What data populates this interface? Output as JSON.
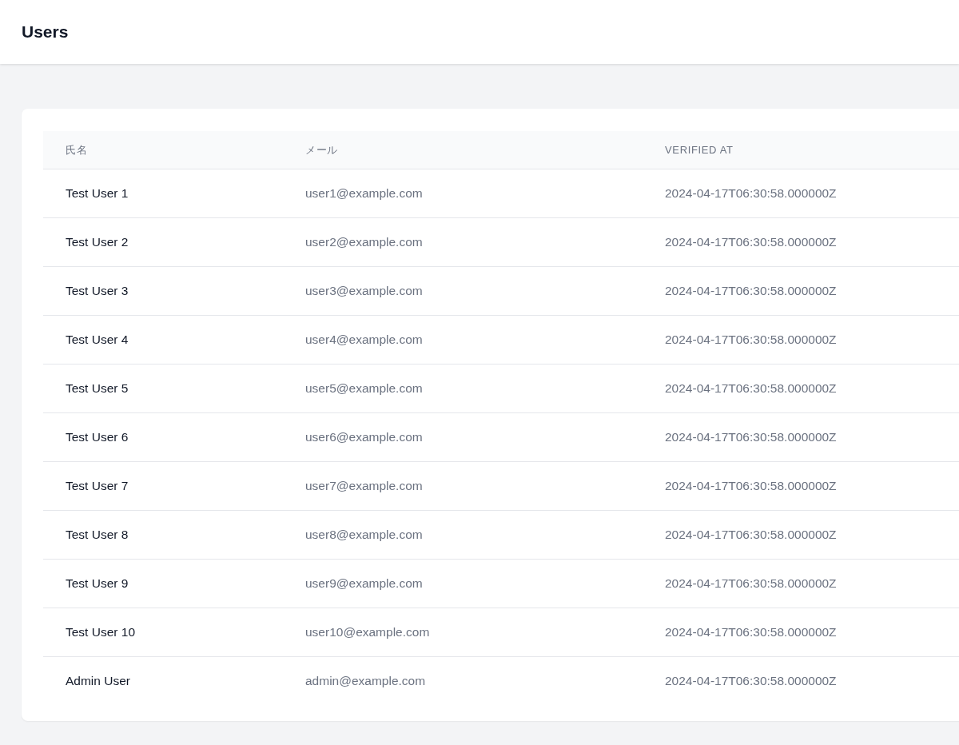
{
  "header": {
    "title": "Users"
  },
  "table": {
    "columns": [
      "氏名",
      "メール",
      "VERIFIED AT"
    ],
    "rows": [
      {
        "name": "Test User 1",
        "email": "user1@example.com",
        "verified_at": "2024-04-17T06:30:58.000000Z"
      },
      {
        "name": "Test User 2",
        "email": "user2@example.com",
        "verified_at": "2024-04-17T06:30:58.000000Z"
      },
      {
        "name": "Test User 3",
        "email": "user3@example.com",
        "verified_at": "2024-04-17T06:30:58.000000Z"
      },
      {
        "name": "Test User 4",
        "email": "user4@example.com",
        "verified_at": "2024-04-17T06:30:58.000000Z"
      },
      {
        "name": "Test User 5",
        "email": "user5@example.com",
        "verified_at": "2024-04-17T06:30:58.000000Z"
      },
      {
        "name": "Test User 6",
        "email": "user6@example.com",
        "verified_at": "2024-04-17T06:30:58.000000Z"
      },
      {
        "name": "Test User 7",
        "email": "user7@example.com",
        "verified_at": "2024-04-17T06:30:58.000000Z"
      },
      {
        "name": "Test User 8",
        "email": "user8@example.com",
        "verified_at": "2024-04-17T06:30:58.000000Z"
      },
      {
        "name": "Test User 9",
        "email": "user9@example.com",
        "verified_at": "2024-04-17T06:30:58.000000Z"
      },
      {
        "name": "Test User 10",
        "email": "user10@example.com",
        "verified_at": "2024-04-17T06:30:58.000000Z"
      },
      {
        "name": "Admin User",
        "email": "admin@example.com",
        "verified_at": "2024-04-17T06:30:58.000000Z"
      }
    ]
  }
}
